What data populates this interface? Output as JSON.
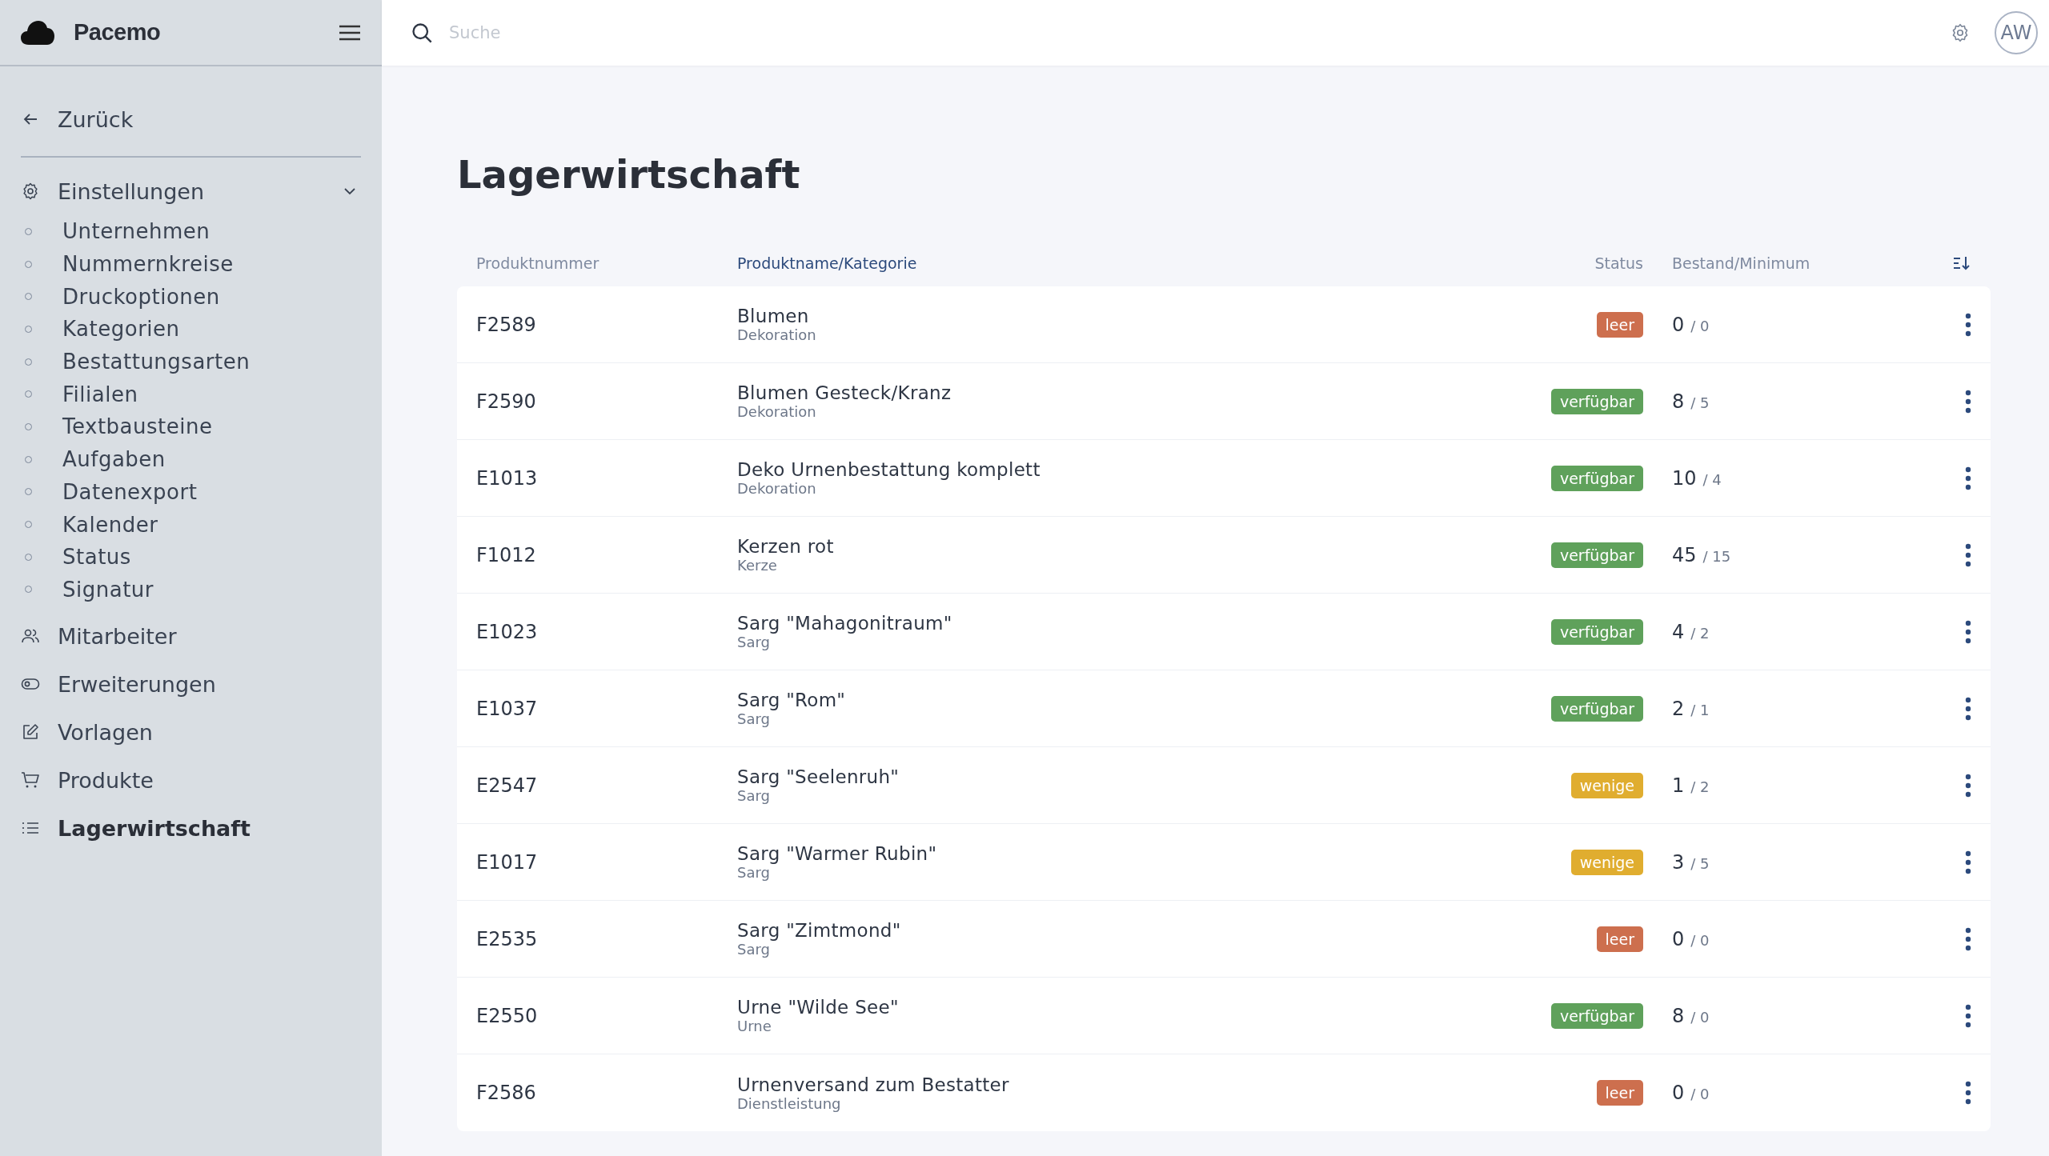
{
  "brand": "Pacemo",
  "back": {
    "label": "Zurück"
  },
  "settings": {
    "label": "Einstellungen",
    "expanded": true,
    "children": [
      {
        "label": "Unternehmen",
        "selected": false
      },
      {
        "label": "Nummernkreise",
        "selected": false
      },
      {
        "label": "Druckoptionen",
        "selected": false
      },
      {
        "label": "Kategorien",
        "selected": false
      },
      {
        "label": "Bestattungsarten",
        "selected": false
      },
      {
        "label": "Filialen",
        "selected": false
      },
      {
        "label": "Textbausteine",
        "selected": false
      },
      {
        "label": "Aufgaben",
        "selected": false
      },
      {
        "label": "Datenexport",
        "selected": false
      },
      {
        "label": "Kalender",
        "selected": false
      },
      {
        "label": "Status",
        "selected": false
      },
      {
        "label": "Signatur",
        "selected": false
      }
    ]
  },
  "nav": [
    {
      "kind": "users",
      "label": "Mitarbeiter",
      "selected": false
    },
    {
      "kind": "toggle",
      "label": "Erweiterungen",
      "selected": false
    },
    {
      "kind": "edit",
      "label": "Vorlagen",
      "selected": false
    },
    {
      "kind": "cart",
      "label": "Produkte",
      "selected": false
    },
    {
      "kind": "list",
      "label": "Lagerwirtschaft",
      "selected": true
    }
  ],
  "search": {
    "placeholder": "Suche"
  },
  "avatar": "AW",
  "title": "Lagerwirtschaft",
  "table": {
    "columns": [
      {
        "label": "Produktnummer",
        "sorted": false
      },
      {
        "label": "Produktname/Kategorie",
        "sorted": true
      },
      {
        "label": "Status",
        "sorted": false
      },
      {
        "label": "Bestand/Minimum",
        "sorted": false
      }
    ],
    "rows": [
      {
        "number": "F2589",
        "name": "Blumen",
        "category": "Dekoration",
        "status": "leer",
        "color": "#cd6f4e",
        "stock": "0",
        "minimum": "/ 0"
      },
      {
        "number": "F2590",
        "name": "Blumen Gesteck/Kranz",
        "category": "Dekoration",
        "status": "verfügbar",
        "color": "#5fa15b",
        "stock": "8",
        "minimum": "/ 5"
      },
      {
        "number": "E1013",
        "name": "Deko Urnenbestattung komplett",
        "category": "Dekoration",
        "status": "verfügbar",
        "color": "#5fa15b",
        "stock": "10",
        "minimum": "/ 4"
      },
      {
        "number": "F1012",
        "name": "Kerzen rot",
        "category": "Kerze",
        "status": "verfügbar",
        "color": "#5fa15b",
        "stock": "45",
        "minimum": "/ 15"
      },
      {
        "number": "E1023",
        "name": "Sarg \"Mahagonitraum\"",
        "category": "Sarg",
        "status": "verfügbar",
        "color": "#5fa15b",
        "stock": "4",
        "minimum": "/ 2"
      },
      {
        "number": "E1037",
        "name": "Sarg \"Rom\"",
        "category": "Sarg",
        "status": "verfügbar",
        "color": "#5fa15b",
        "stock": "2",
        "minimum": "/ 1"
      },
      {
        "number": "E2547",
        "name": "Sarg \"Seelenruh\"",
        "category": "Sarg",
        "status": "wenige",
        "color": "#e0ad2f",
        "stock": "1",
        "minimum": "/ 2"
      },
      {
        "number": "E1017",
        "name": "Sarg \"Warmer Rubin\"",
        "category": "Sarg",
        "status": "wenige",
        "color": "#e0ad2f",
        "stock": "3",
        "minimum": "/ 5"
      },
      {
        "number": "E2535",
        "name": "Sarg \"Zimtmond\"",
        "category": "Sarg",
        "status": "leer",
        "color": "#cd6f4e",
        "stock": "0",
        "minimum": "/ 0"
      },
      {
        "number": "E2550",
        "name": "Urne \"Wilde See\"",
        "category": "Urne",
        "status": "verfügbar",
        "color": "#5fa15b",
        "stock": "8",
        "minimum": "/ 0"
      },
      {
        "number": "F2586",
        "name": "Urnenversand zum Bestatter",
        "category": "Dienstleistung",
        "status": "leer",
        "color": "#cd6f4e",
        "stock": "0",
        "minimum": "/ 0"
      }
    ]
  }
}
